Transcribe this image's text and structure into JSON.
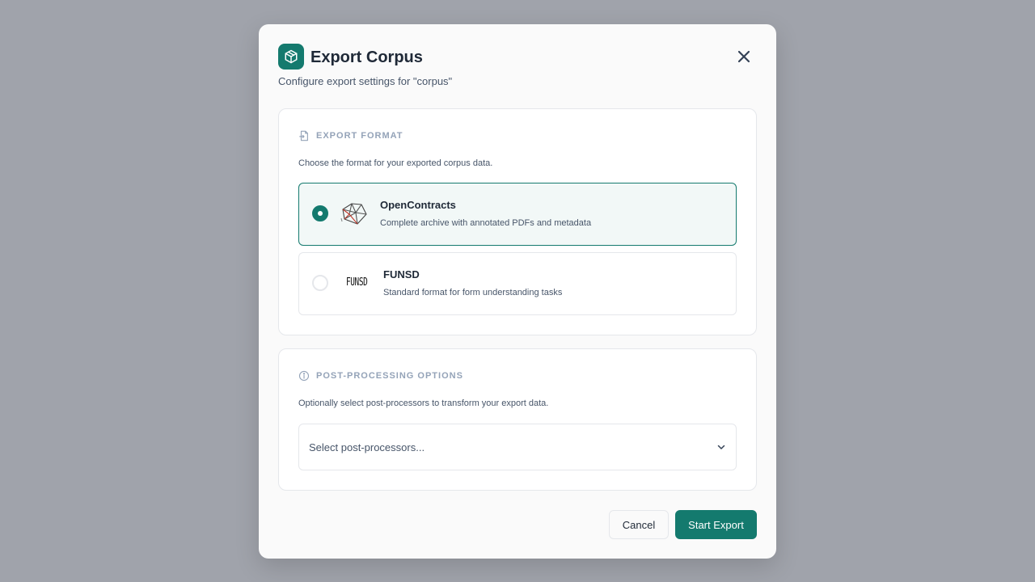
{
  "dialog": {
    "title": "Export Corpus",
    "subtitle": "Configure export settings for \"corpus\"",
    "icon": "package-icon"
  },
  "export_format": {
    "heading": "EXPORT FORMAT",
    "description": "Choose the format for your exported corpus data.",
    "options": [
      {
        "name": "OpenContracts",
        "description": "Complete archive with annotated PDFs and metadata",
        "selected": true
      },
      {
        "name": "FUNSD",
        "logo_text": "FUNSD",
        "description": "Standard format for form understanding tasks",
        "selected": false
      }
    ]
  },
  "post_processing": {
    "heading": "POST-PROCESSING OPTIONS",
    "description": "Optionally select post-processors to transform your export data.",
    "placeholder": "Select post-processors..."
  },
  "footer": {
    "cancel_label": "Cancel",
    "start_label": "Start Export"
  },
  "colors": {
    "accent": "#147a6e",
    "overlay": "#a0a3ab"
  }
}
